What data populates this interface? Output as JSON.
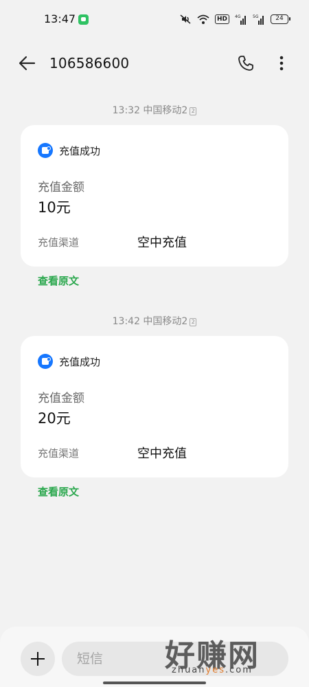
{
  "status_bar": {
    "time": "13:47",
    "hd": "HD",
    "net1": "4G",
    "net2": "5G",
    "battery": "24",
    "icons": [
      "message-app-icon",
      "mute-icon",
      "wifi-icon",
      "hd-icon",
      "signal-icon",
      "signal-icon",
      "battery-icon"
    ]
  },
  "header": {
    "title": "106586600",
    "icons": [
      "back-arrow-icon",
      "phone-icon",
      "more-vertical-icon"
    ]
  },
  "messages": [
    {
      "timestamp": "13:32 中国移动2",
      "sim": "2",
      "title": "充值成功",
      "amount_label": "充值金额",
      "amount": "10元",
      "channel_label": "充值渠道",
      "channel": "空中充值",
      "link": "查看原文"
    },
    {
      "timestamp": "13:42 中国移动2",
      "sim": "2",
      "title": "充值成功",
      "amount_label": "充值金额",
      "amount": "20元",
      "channel_label": "充值渠道",
      "channel": "空中充值",
      "link": "查看原文"
    }
  ],
  "composer": {
    "placeholder": "短信"
  },
  "watermark": {
    "main": "好赚网",
    "url_prefix": "zhuan",
    "url_accent": "yes",
    "url_suffix": ".com"
  },
  "colors": {
    "background": "#f2f2f2",
    "card": "#ffffff",
    "link_green": "#2aa74d",
    "app_blue": "#1677ff"
  }
}
